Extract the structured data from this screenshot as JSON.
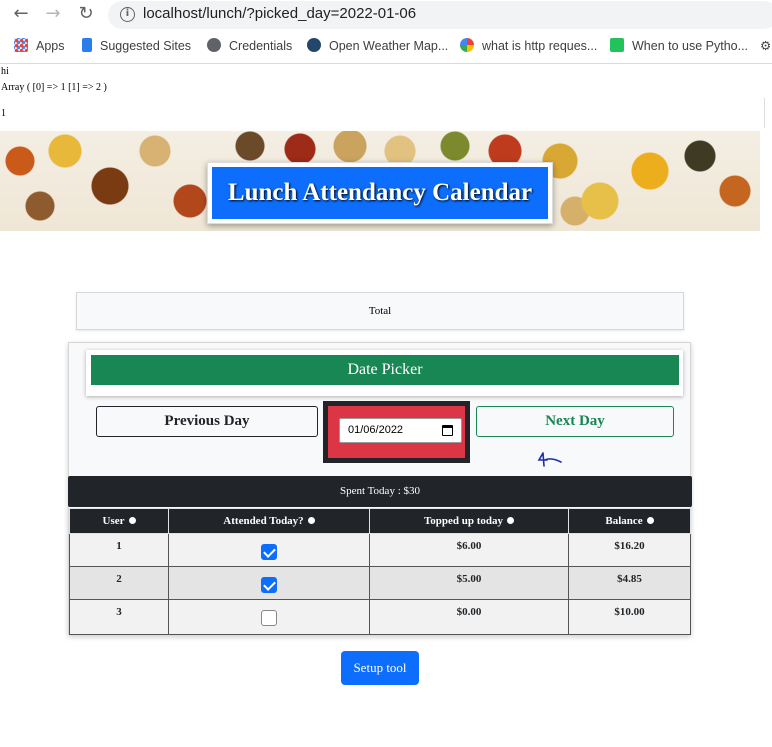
{
  "browser": {
    "url": "localhost/lunch/?picked_day=2022-01-06",
    "bookmarks": [
      {
        "label": "Apps",
        "icon": "apps-grid-icon",
        "color": "#4285f4"
      },
      {
        "label": "Suggested Sites",
        "icon": "bing-icon",
        "color": "#2b7de9"
      },
      {
        "label": "Credentials",
        "icon": "globe-icon",
        "color": "#5f6368"
      },
      {
        "label": "Open Weather Map...",
        "icon": "openweather-icon",
        "color": "#24466b"
      },
      {
        "label": "what is http reques...",
        "icon": "google-icon",
        "color": "#ea4335"
      },
      {
        "label": "When to use Pytho...",
        "icon": "site-icon",
        "color": "#21c35a"
      }
    ]
  },
  "debug": {
    "line1": "hi",
    "line2": "Array ( [0] => 1 [1] => 2 )",
    "line3": "1"
  },
  "header": {
    "title": "Lunch Attendancy Calendar"
  },
  "total": {
    "label": "Total"
  },
  "date_picker": {
    "heading": "Date Picker",
    "prev_label": "Previous Day",
    "next_label": "Next Day",
    "date_value": "01/06/2022"
  },
  "spent": {
    "text": "Spent Today : $30"
  },
  "table": {
    "headers": [
      "User",
      "Attended Today?",
      "Topped up today",
      "Balance"
    ],
    "rows": [
      {
        "user": "1",
        "attended": true,
        "topped": "$6.00",
        "balance": "$16.20"
      },
      {
        "user": "2",
        "attended": true,
        "topped": "$5.00",
        "balance": "$4.85"
      },
      {
        "user": "3",
        "attended": false,
        "topped": "$0.00",
        "balance": "$10.00"
      }
    ]
  },
  "footer": {
    "setup_label": "Setup tool"
  },
  "colors": {
    "primary": "#0d6efd",
    "success": "#198754",
    "danger": "#dc3545",
    "dark": "#212529"
  }
}
